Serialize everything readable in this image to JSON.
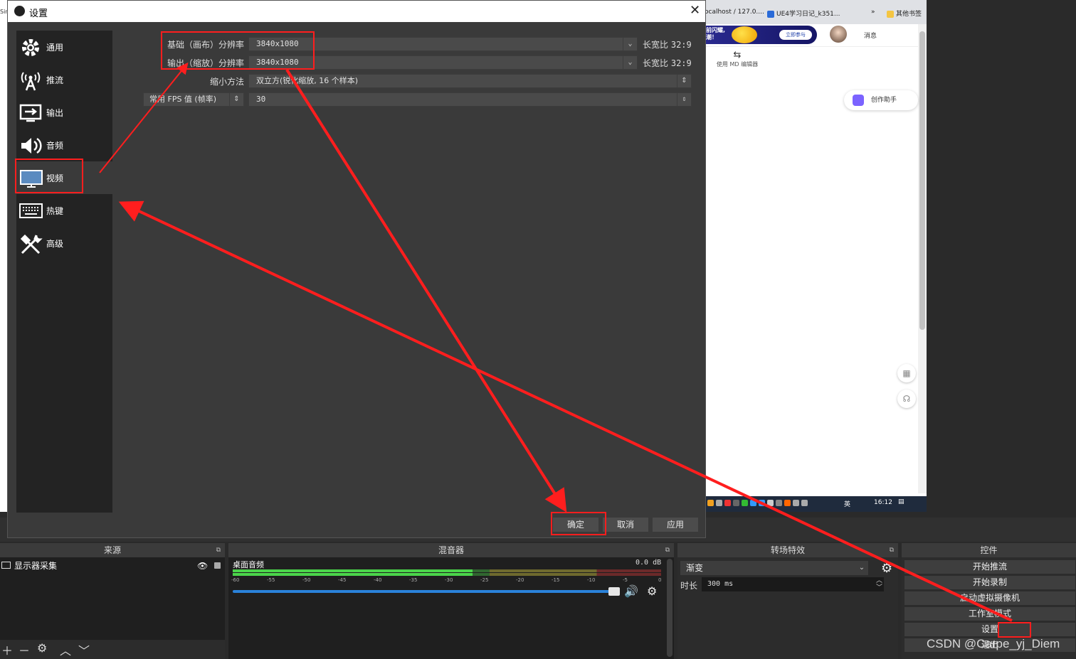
{
  "browser": {
    "bookmarks": [
      "ocalhost / 127.0....",
      "UE4学习日记_k351...",
      "»",
      "其他书签"
    ],
    "banner_text": "前闪耀,\n潮！",
    "banner_button": "立即参与",
    "messages_label": "消息",
    "md_editor_label": "使用 MD 编辑器",
    "assistant_label": "创作助手",
    "taskbar_ime": "英",
    "taskbar_clock": "16:12"
  },
  "dialog": {
    "title": "设置",
    "nav": [
      {
        "label": "通用",
        "icon": "gear-icon"
      },
      {
        "label": "推流",
        "icon": "antenna-icon"
      },
      {
        "label": "输出",
        "icon": "output-icon"
      },
      {
        "label": "音频",
        "icon": "speaker-icon"
      },
      {
        "label": "视频",
        "icon": "monitor-icon"
      },
      {
        "label": "热键",
        "icon": "keyboard-icon"
      },
      {
        "label": "高级",
        "icon": "tools-icon"
      }
    ],
    "video": {
      "base_label": "基础（画布）分辨率",
      "base_value": "3840x1080",
      "base_ratio_label": "长宽比",
      "base_ratio": "32:9",
      "output_label": "输出（缩放）分辨率",
      "output_value": "3840x1080",
      "output_ratio_label": "长宽比",
      "output_ratio": "32:9",
      "downscale_label": "缩小方法",
      "downscale_value": "双立方(锐化缩放, 16 个样本)",
      "fps_label": "常用 FPS 值 (帧率)",
      "fps_value": "30"
    },
    "buttons": {
      "ok": "确定",
      "cancel": "取消",
      "apply": "应用"
    }
  },
  "obs": {
    "sources": {
      "title": "来源",
      "items": [
        "显示器采集"
      ]
    },
    "mixer": {
      "title": "混音器",
      "track": "桌面音频",
      "db": "0.0 dB",
      "ticks": [
        "-60",
        "-55",
        "-50",
        "-45",
        "-40",
        "-35",
        "-30",
        "-25",
        "-20",
        "-15",
        "-10",
        "-5",
        "0"
      ]
    },
    "transitions": {
      "title": "转场特效",
      "selected": "渐变",
      "duration_label": "时长",
      "duration_value": "300 ms"
    },
    "controls": {
      "title": "控件",
      "buttons": [
        "开始推流",
        "开始录制",
        "启动虚拟摄像机",
        "工作室模式",
        "设置",
        "退出"
      ]
    }
  },
  "watermark": "CSDN @Carpe_yj_Diem",
  "colors": {
    "annotation": "#ff1e1e",
    "dialog_bg": "#3a3a3a",
    "nav_bg": "#232323"
  }
}
